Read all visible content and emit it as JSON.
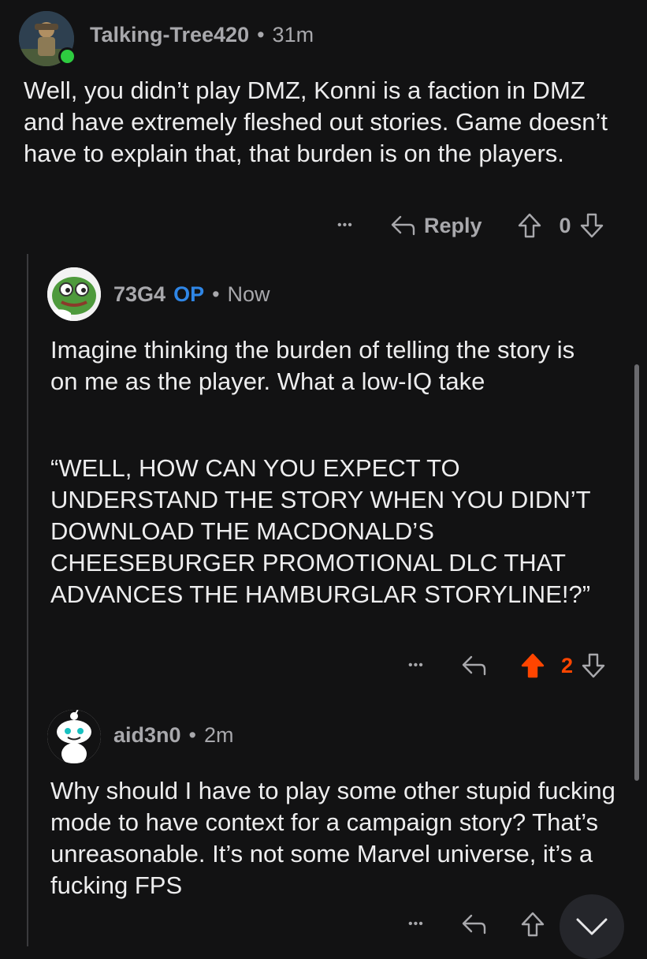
{
  "comments": [
    {
      "author": "Talking-Tree420",
      "time": "31m",
      "body": "Well, you didn’t play DMZ, Konni is a faction in DMZ and have extremely fleshed out stories. Game doesn’t have to explain that, that burden is on the players.",
      "reply_label": "Reply",
      "score": "0",
      "online": true
    },
    {
      "author": "73G4",
      "badge": "OP",
      "time": "Now",
      "body_1": "Imagine thinking the burden of telling the story is on me as the player. What a low-IQ take",
      "body_2": "“WELL, HOW CAN YOU EXPECT TO UNDERSTAND THE STORY WHEN YOU DIDN’T DOWNLOAD THE MACDONALD’S CHEESEBURGER PROMOTIONAL DLC THAT ADVANCES THE HAMBURGLAR STORYLINE!?”",
      "score": "2",
      "upvoted": true
    },
    {
      "author": "aid3n0",
      "time": "2m",
      "body": "Why should I have to play some other stupid fucking mode to have context for a campaign story? That’s unreasonable. It’s not some Marvel universe, it’s a fucking FPS"
    }
  ],
  "separator": "•",
  "more_label": "•••",
  "colors": {
    "background": "#121213",
    "upvote_active": "#ff4500",
    "op_badge": "#2f86e6",
    "online": "#2ecc40"
  },
  "icons": [
    "more-icon",
    "reply-arrow-icon",
    "upvote-icon",
    "downvote-icon",
    "chevron-down-icon"
  ]
}
